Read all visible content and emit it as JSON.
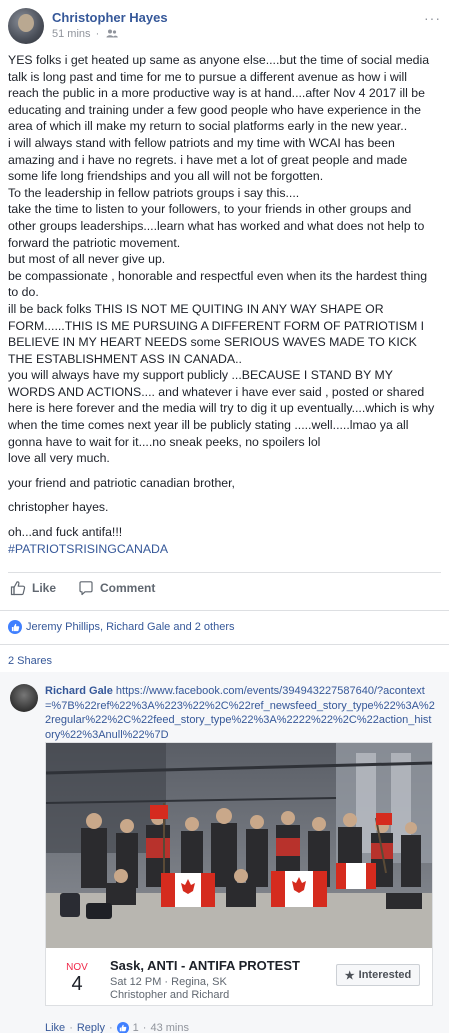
{
  "post": {
    "author": "Christopher Hayes",
    "time": "51 mins",
    "separator": "·",
    "more_icon": "···",
    "paragraphs": [
      "YES folks i get heated up same as anyone else....but the time of social media talk is long past and time for me to pursue a different avenue as how i will reach the public in a more productive way is at hand....after Nov 4 2017 ill be educating and training under a few good people who have experience in the area of which ill make my return to social platforms early in the new year..",
      "i will always stand with fellow patriots and my time with WCAI has been amazing and i have no regrets. i have met a lot of great people and made some life long friendships and you all will not be forgotten.",
      "To the leadership in fellow patriots groups i say this....",
      "take the time to listen to your followers, to your friends in other groups and other groups leaderships....learn what has worked and what does not help to forward the patriotic movement.",
      "but most of all never give up.",
      "be compassionate , honorable and respectful even when its the hardest thing to do.",
      "ill be back folks THIS IS NOT ME QUITING IN ANY WAY SHAPE OR FORM......THIS IS ME PURSUING A DIFFERENT FORM OF PATRIOTISM I BELIEVE IN MY HEART NEEDS some SERIOUS WAVES MADE TO KICK THE ESTABLISHMENT ASS IN CANADA..",
      "you will always have my support publicly ...BECAUSE I STAND BY MY WORDS AND ACTIONS.... and whatever i have ever said , posted or shared here is here forever and the media will try to dig it up eventually....which is why when the time comes next year ill be publicly stating .....well.....lmao ya all gonna have to wait for it....no sneak peeks, no spoilers lol",
      "love all very much."
    ],
    "signoff_1": "your friend and patriotic canadian brother,",
    "signoff_2": "christopher hayes.",
    "signoff_3": "oh...and fuck antifa!!!",
    "hashtag": "#PATRIOTSRISINGCANADA"
  },
  "actions": {
    "like_label": "Like",
    "comment_label": "Comment"
  },
  "reactions": {
    "text": "Jeremy Phillips, Richard Gale and 2 others"
  },
  "shares": {
    "text": "2 Shares"
  },
  "comment": {
    "author": "Richard Gale",
    "link": "https://www.facebook.com/events/394943227587640/?acontext=%7B%22ref%22%3A%223%22%2C%22ref_newsfeed_story_type%22%3A%22regular%22%2C%22feed_story_type%22%3A%2222%22%2C%22action_history%22%3Anull%22%7D",
    "event": {
      "month": "NOV",
      "day": "4",
      "title": "Sask, ANTI - ANTIFA PROTEST",
      "when_where": "Sat 12 PM · Regina, SK",
      "guests": "Christopher and Richard",
      "interested_label": "Interested"
    },
    "footer": {
      "like": "Like",
      "reply": "Reply",
      "dot": "·",
      "like_count": "1",
      "time": "43 mins"
    }
  },
  "colors": {
    "link_blue": "#365899",
    "like_blue": "#4080ff",
    "month_red": "#f02849",
    "canada_red": "#d52b1e"
  }
}
